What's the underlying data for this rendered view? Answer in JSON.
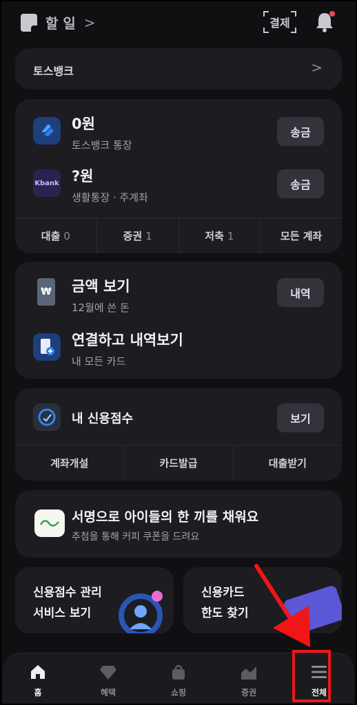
{
  "topbar": {
    "todo_label": "할 일",
    "todo_chevron": ">",
    "pay_label": "결제"
  },
  "tossbank_card": {
    "title": "토스뱅크",
    "chevron": ">"
  },
  "accounts": {
    "items": [
      {
        "balance": "0원",
        "name": "토스뱅크 통장",
        "action": "송금"
      },
      {
        "balance": "?원",
        "name": "생활통장 · 주계좌",
        "action": "송금",
        "bank_logo_text": "Kbank"
      }
    ],
    "tabs": [
      {
        "label": "대출",
        "count": "0"
      },
      {
        "label": "증권",
        "count": "1"
      },
      {
        "label": "저축",
        "count": "1"
      },
      {
        "label": "모든 계좌",
        "count": ""
      }
    ]
  },
  "spending": {
    "items": [
      {
        "title": "금액 보기",
        "sub": "12월에 쓴 돈",
        "action": "내역"
      },
      {
        "title": "연결하고 내역보기",
        "sub": "내 모든 카드"
      }
    ]
  },
  "credit": {
    "title": "내 신용점수",
    "action": "보기",
    "links": [
      "계좌개설",
      "카드발급",
      "대출받기"
    ]
  },
  "banner": {
    "title": "서명으로 아이들의 한 끼를 채워요",
    "sub": "추첨을 통해 커피 쿠폰을 드려요"
  },
  "promos": [
    {
      "line1": "신용점수 관리",
      "line2": "서비스 보기"
    },
    {
      "line1": "신용카드",
      "line2": "한도 찾기"
    }
  ],
  "tabbar": {
    "tabs": [
      {
        "label": "홈",
        "icon": "home-icon",
        "active": true
      },
      {
        "label": "혜택",
        "icon": "diamond-icon",
        "active": false
      },
      {
        "label": "쇼핑",
        "icon": "shopping-bag-icon",
        "active": false
      },
      {
        "label": "증권",
        "icon": "stock-chart-icon",
        "active": false
      },
      {
        "label": "전체",
        "icon": "menu-icon",
        "active": false
      }
    ]
  },
  "colors": {
    "background": "#101013",
    "card": "#1c1c21",
    "accent_blue": "#3182f6",
    "highlight_red": "#f01616",
    "notification_dot": "#f2455c"
  }
}
